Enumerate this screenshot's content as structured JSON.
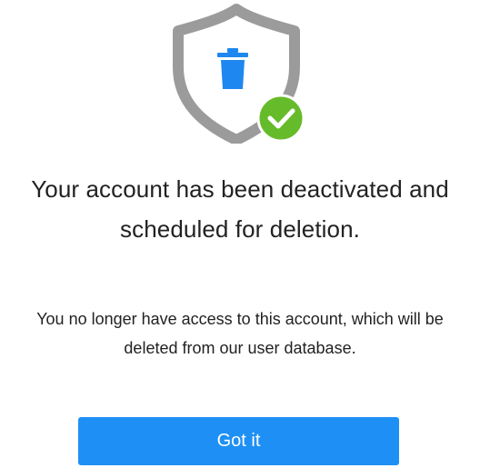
{
  "dialog": {
    "illustration": {
      "icons": [
        "shield-icon",
        "trash-icon",
        "checkmark-icon"
      ],
      "colors": {
        "shield": "#9b9b9b",
        "trash": "#1e88f0",
        "check_badge": "#66bb2a"
      }
    },
    "title_lines": [
      "Your account has been deactivated and",
      "scheduled for deletion."
    ],
    "message_lines": [
      "You no longer have access to this account, which will be",
      "deleted from our user database."
    ],
    "confirm_button": {
      "label": "Got it",
      "color": "#1e90f5"
    }
  }
}
